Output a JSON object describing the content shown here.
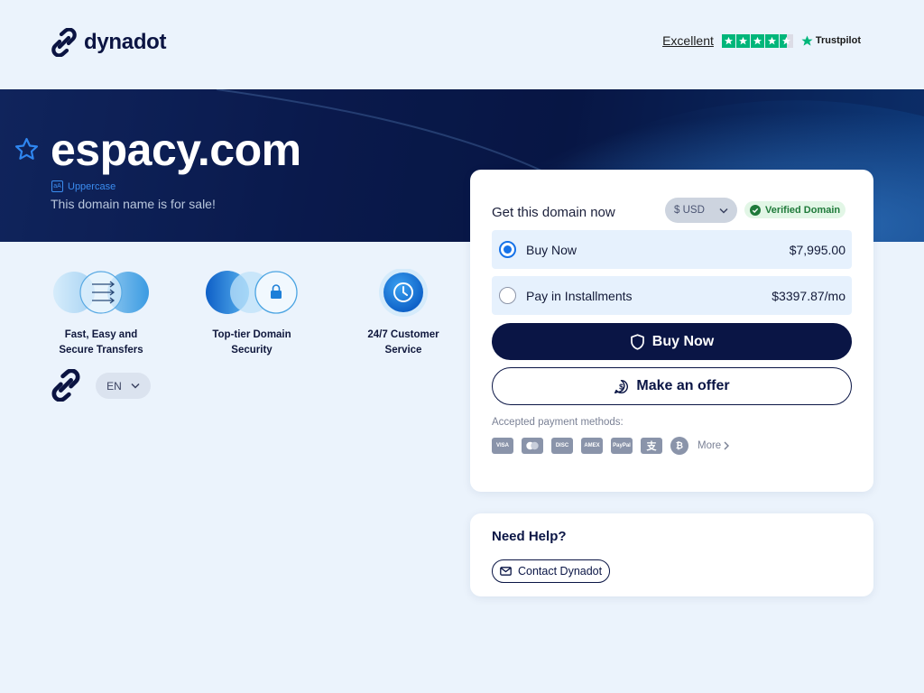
{
  "header": {
    "logo_text": "dynadot",
    "trustpilot_rating": "Excellent",
    "trustpilot_brand": "Trustpilot",
    "trustpilot_stars": 4.5
  },
  "hero": {
    "domain_name": "espacy.com",
    "tag_label": "Uppercase",
    "subtitle": "This domain name is for sale!"
  },
  "features": [
    {
      "line1": "Fast, Easy and",
      "line2": "Secure Transfers",
      "icon": "transfer-icon"
    },
    {
      "line1": "Top-tier Domain",
      "line2": "Security",
      "icon": "lock-icon"
    },
    {
      "line1": "24/7 Customer",
      "line2": "Service",
      "icon": "clock-icon"
    }
  ],
  "language": {
    "selected": "EN"
  },
  "purchase": {
    "title": "Get this domain now",
    "currency": "$ USD",
    "verified_label": "Verified Domain",
    "options": [
      {
        "label": "Buy Now",
        "price": "$7,995.00",
        "selected": true
      },
      {
        "label": "Pay in Installments",
        "price": "$3397.87/mo",
        "selected": false
      }
    ],
    "buy_button": "Buy Now",
    "offer_button": "Make an offer",
    "payment_label": "Accepted payment methods:",
    "payment_methods": [
      "VISA",
      "MC",
      "DISC",
      "AMEX",
      "PayPal",
      "Alipay",
      "Bitcoin"
    ],
    "more_label": "More"
  },
  "help": {
    "title": "Need Help?",
    "contact_button": "Contact Dynadot"
  },
  "colors": {
    "navy": "#0a1545",
    "accent_blue": "#1672e8",
    "trustpilot_green": "#00b67a",
    "background": "#ebf3fc"
  }
}
